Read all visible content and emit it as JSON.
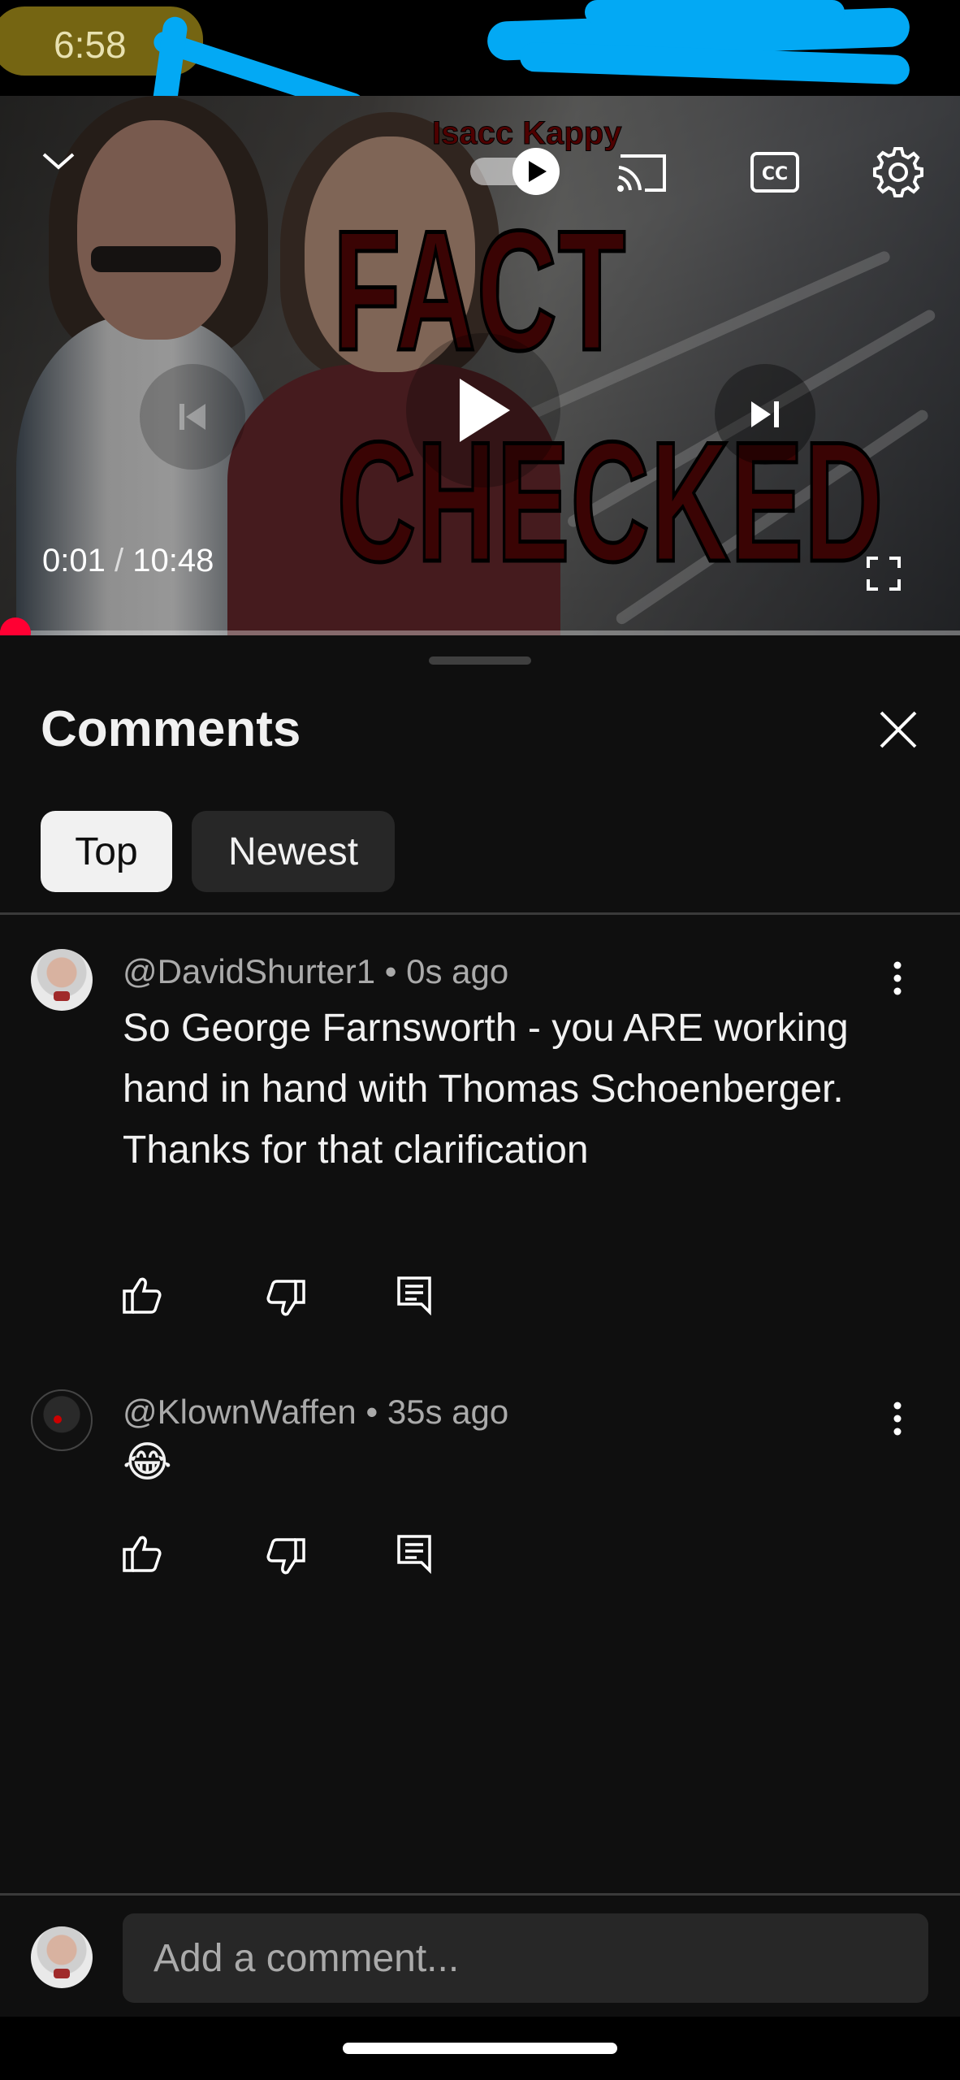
{
  "status_bar": {
    "time": "6:58"
  },
  "video": {
    "thumbnail_text": {
      "small": "Isacc Kappy",
      "line1": "FACT",
      "line2": "CHECKED"
    },
    "current_time": "0:01",
    "separator": "/",
    "duration": "10:48",
    "progress_fraction": 0.002
  },
  "comments_panel": {
    "title": "Comments",
    "tabs": [
      {
        "label": "Top",
        "selected": true
      },
      {
        "label": "Newest",
        "selected": false
      }
    ],
    "comments": [
      {
        "author": "@DavidShurter1",
        "time": "0s ago",
        "text": "So George Farnsworth - you ARE working hand in hand with Thomas Schoenberger. Thanks for that clarification"
      },
      {
        "author": "@KlownWaffen",
        "time": "35s ago",
        "text": "😂"
      }
    ],
    "add_comment_placeholder": "Add a comment..."
  },
  "colors": {
    "accent_red": "#ff0033",
    "background": "#0f0f0f",
    "chip_bg": "#272727",
    "annotation_blue": "#03a9f4"
  }
}
